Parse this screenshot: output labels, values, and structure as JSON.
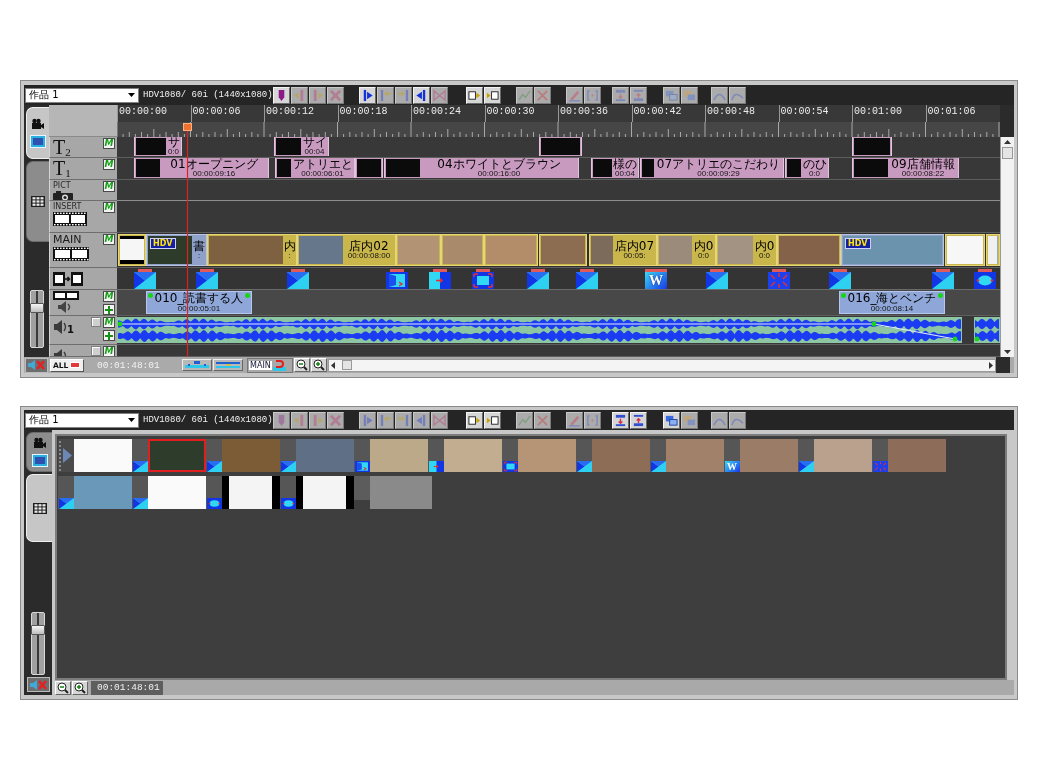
{
  "timeline_panel": {
    "project_dropdown": {
      "value": "作品 1"
    },
    "format": "HDV1080/ 60i (1440x1080)",
    "toolbar_groups": [
      {
        "buttons": [
          {
            "kind": "flag",
            "disabled": false
          },
          {
            "kind": "in",
            "disabled": true
          },
          {
            "kind": "out",
            "disabled": true
          },
          {
            "kind": "clear",
            "disabled": true
          }
        ]
      },
      {
        "buttons": [
          {
            "kind": "go-start",
            "disabled": false
          },
          {
            "kind": "trim-left",
            "disabled": true
          },
          {
            "kind": "trim-right",
            "disabled": true
          },
          {
            "kind": "go-end",
            "disabled": false
          },
          {
            "kind": "bowtie",
            "disabled": true
          }
        ]
      },
      {
        "buttons": [
          {
            "kind": "insert-left",
            "disabled": false
          },
          {
            "kind": "insert-right",
            "disabled": false
          }
        ]
      },
      {
        "buttons": [
          {
            "kind": "graph",
            "disabled": true
          },
          {
            "kind": "cross",
            "disabled": true
          }
        ]
      },
      {
        "buttons": [
          {
            "kind": "pen",
            "disabled": true
          },
          {
            "kind": "brackets",
            "disabled": true
          }
        ]
      },
      {
        "buttons": [
          {
            "kind": "title-up",
            "disabled": true
          },
          {
            "kind": "title-down",
            "disabled": true
          }
        ]
      },
      {
        "buttons": [
          {
            "kind": "layers",
            "disabled": true
          },
          {
            "kind": "layers-alt",
            "disabled": true
          }
        ]
      },
      {
        "buttons": [
          {
            "kind": "curve",
            "disabled": true
          },
          {
            "kind": "curve-alt",
            "disabled": true
          }
        ]
      }
    ],
    "view_tabs": [
      {
        "kind": "timeline",
        "selected": true
      },
      {
        "kind": "storyboard",
        "selected": false
      }
    ],
    "ruler": [
      "00:00:00",
      "00:00:06",
      "00:00:12",
      "00:00:18",
      "00:00:24",
      "00:00:30",
      "00:00:36",
      "00:00:42",
      "00:00:48",
      "00:00:54",
      "00:01:00",
      "00:01:06"
    ],
    "tracks": [
      {
        "kind": "title",
        "label": "T$_{2}$",
        "monitor": "M",
        "clips": [
          {
            "kind": "labeled",
            "title": "サ",
            "timecode": "0:0"
          },
          {
            "kind": "labeled",
            "title": "サイ",
            "timecode": "00:04"
          },
          {
            "kind": "thumb"
          },
          {
            "kind": "thumb"
          }
        ]
      },
      {
        "kind": "title",
        "label": "T$_{1}$",
        "monitor": "M",
        "clips": [
          {
            "kind": "labeled",
            "title": "01オープニング",
            "timecode": "00:00:09:16"
          },
          {
            "kind": "labeled",
            "title": "アトリエと",
            "timecode": "00:00:06:01"
          },
          {
            "kind": "thumb"
          },
          {
            "kind": "labeled",
            "title": "04ホワイトとブラウン",
            "timecode": "00:00:16:00"
          },
          {
            "kind": "labeled",
            "title": "様の",
            "timecode": "00:04"
          },
          {
            "kind": "labeled",
            "title": "07アトリエのこだわり",
            "timecode": "00:00:09:29"
          },
          {
            "kind": "labeled",
            "title": "のひ",
            "timecode": "0:0"
          },
          {
            "kind": "labeled",
            "title": "09店舗情報",
            "timecode": "00:00:08:22"
          }
        ]
      },
      {
        "kind": "pict",
        "label": "PICT",
        "monitor": "M"
      },
      {
        "kind": "insert",
        "label": "INSERT",
        "monitor": "M"
      },
      {
        "kind": "main",
        "label": "MAIN",
        "monitor": "M",
        "clips": [
          {
            "kind": "thumb"
          },
          {
            "kind": "hdv",
            "badge": "HDV",
            "title": "書",
            "timecode": ":"
          },
          {
            "kind": "labeled",
            "title": "内",
            "timecode": ":"
          },
          {
            "kind": "labeled",
            "title": "店内02",
            "timecode": "00:00:08:00"
          },
          {
            "kind": "thumb"
          },
          {
            "kind": "thumb"
          },
          {
            "kind": "thumb"
          },
          {
            "kind": "thumb"
          },
          {
            "kind": "labeled",
            "title": "店内07",
            "timecode": "00:05:"
          },
          {
            "kind": "labeled",
            "title": "内0",
            "timecode": "0:0"
          },
          {
            "kind": "labeled",
            "title": "内0",
            "timecode": "0:0"
          },
          {
            "kind": "thumb"
          },
          {
            "kind": "hdv",
            "badge": "HDV"
          },
          {
            "kind": "thumb"
          },
          {
            "kind": "thumb"
          }
        ]
      },
      {
        "kind": "transition",
        "transitions": [
          {
            "kind": "diagonal"
          },
          {
            "kind": "diagonal"
          },
          {
            "kind": "diagonal"
          },
          {
            "kind": "door"
          },
          {
            "kind": "slide"
          },
          {
            "kind": "zoom"
          },
          {
            "kind": "diagonal"
          },
          {
            "kind": "diagonal"
          },
          {
            "kind": "wipe",
            "label": "W"
          },
          {
            "kind": "diagonal"
          },
          {
            "kind": "converge"
          },
          {
            "kind": "diagonal"
          },
          {
            "kind": "diagonal"
          },
          {
            "kind": "blob"
          }
        ]
      },
      {
        "kind": "voice",
        "monitor": "M",
        "add_button": true,
        "clips": [
          {
            "title": "010_読書する人",
            "timecode": "00:00:05:01"
          },
          {
            "title": "016_海とベンチ",
            "timecode": "00:00:08:14"
          }
        ]
      },
      {
        "kind": "audio",
        "label": "1",
        "monitor": "M",
        "add_button": true,
        "clips": [
          {
            "kind": "audio"
          },
          {
            "kind": "audio"
          }
        ]
      },
      {
        "kind": "audio",
        "monitor": "M"
      }
    ],
    "volume_slider": {
      "level": 0.73
    },
    "footer": {
      "all_button": "ALL",
      "timecode": "00:01:48:01",
      "main_button": "MAIN"
    }
  },
  "storyboard_panel": {
    "project_dropdown": {
      "value": "作品 1"
    },
    "format": "HDV1080/ 60i (1440x1080)",
    "toolbar_groups": [
      {
        "buttons": [
          {
            "kind": "flag",
            "disabled": true
          },
          {
            "kind": "in",
            "disabled": true
          },
          {
            "kind": "out",
            "disabled": true
          },
          {
            "kind": "clear",
            "disabled": true
          }
        ]
      },
      {
        "buttons": [
          {
            "kind": "go-start",
            "disabled": true
          },
          {
            "kind": "trim-left",
            "disabled": true
          },
          {
            "kind": "trim-right",
            "disabled": true
          },
          {
            "kind": "go-end",
            "disabled": true
          },
          {
            "kind": "bowtie",
            "disabled": true
          }
        ]
      },
      {
        "buttons": [
          {
            "kind": "insert-left",
            "disabled": false
          },
          {
            "kind": "insert-right",
            "disabled": false
          }
        ]
      },
      {
        "buttons": [
          {
            "kind": "graph",
            "disabled": true
          },
          {
            "kind": "cross",
            "disabled": true
          }
        ]
      },
      {
        "buttons": [
          {
            "kind": "pen",
            "disabled": true
          },
          {
            "kind": "brackets",
            "disabled": true
          }
        ]
      },
      {
        "buttons": [
          {
            "kind": "title-up",
            "disabled": false
          },
          {
            "kind": "title-down",
            "disabled": false
          }
        ]
      },
      {
        "buttons": [
          {
            "kind": "layers",
            "disabled": false
          },
          {
            "kind": "layers-alt",
            "disabled": true
          }
        ]
      },
      {
        "buttons": [
          {
            "kind": "curve",
            "disabled": true
          },
          {
            "kind": "curve-alt",
            "disabled": true
          }
        ]
      }
    ],
    "view_tabs": [
      {
        "kind": "timeline",
        "selected": false
      },
      {
        "kind": "storyboard",
        "selected": true
      }
    ],
    "items": [
      {
        "kind": "start"
      },
      {
        "kind": "clip",
        "selected": false
      },
      {
        "kind": "diagonal"
      },
      {
        "kind": "clip",
        "selected": true
      },
      {
        "kind": "diagonal"
      },
      {
        "kind": "clip",
        "selected": false
      },
      {
        "kind": "diagonal"
      },
      {
        "kind": "clip",
        "selected": false
      },
      {
        "kind": "door"
      },
      {
        "kind": "clip",
        "selected": false
      },
      {
        "kind": "slide"
      },
      {
        "kind": "clip",
        "selected": false
      },
      {
        "kind": "zoom"
      },
      {
        "kind": "clip",
        "selected": false
      },
      {
        "kind": "diagonal"
      },
      {
        "kind": "clip",
        "selected": false
      },
      {
        "kind": "diagonal"
      },
      {
        "kind": "clip",
        "selected": false
      },
      {
        "kind": "wipe",
        "label": "W"
      },
      {
        "kind": "clip",
        "selected": false
      },
      {
        "kind": "diagonal"
      },
      {
        "kind": "clip",
        "selected": false
      },
      {
        "kind": "converge"
      },
      {
        "kind": "clip",
        "selected": false
      },
      {
        "kind": "diagonal"
      },
      {
        "kind": "clip",
        "selected": false
      },
      {
        "kind": "diagonal"
      },
      {
        "kind": "clip",
        "selected": false
      },
      {
        "kind": "blob"
      },
      {
        "kind": "clip",
        "selected": false
      },
      {
        "kind": "blob"
      },
      {
        "kind": "clip",
        "selected": false
      },
      {
        "kind": "end"
      }
    ],
    "volume_slider": {
      "level": 0.76
    },
    "footer": {
      "timecode": "00:01:48:01"
    }
  }
}
